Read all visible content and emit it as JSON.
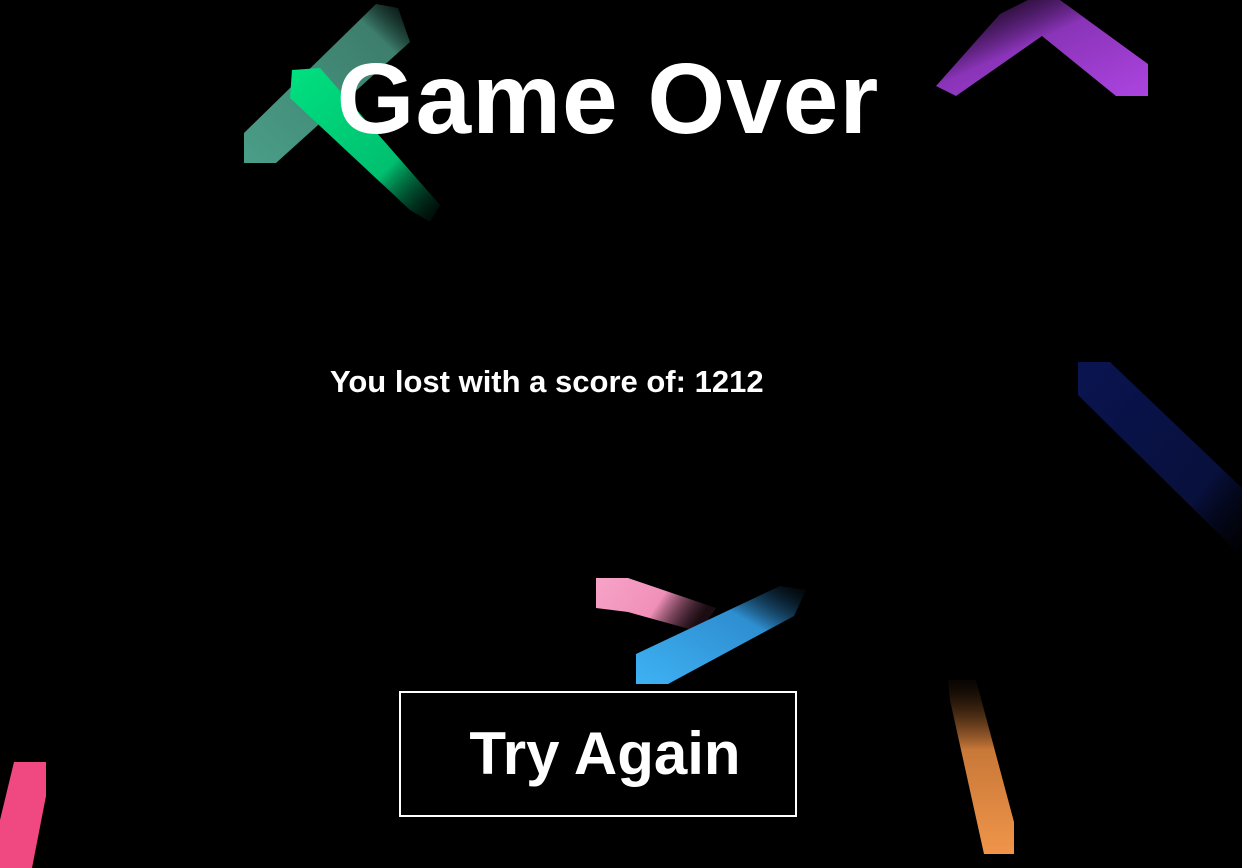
{
  "game_over": {
    "title": "Game Over",
    "score_prefix": "You lost with a score of:",
    "score": "1212",
    "retry_label": "Try Again"
  },
  "streak_colors": {
    "teal": "#4a9e88",
    "green": "#00d97e",
    "purple": "#a23fd6",
    "navy": "#0a1450",
    "pink": "#f5a0c4",
    "blue": "#3aaef0",
    "orange": "#f0954a",
    "rose": "#f04880"
  }
}
